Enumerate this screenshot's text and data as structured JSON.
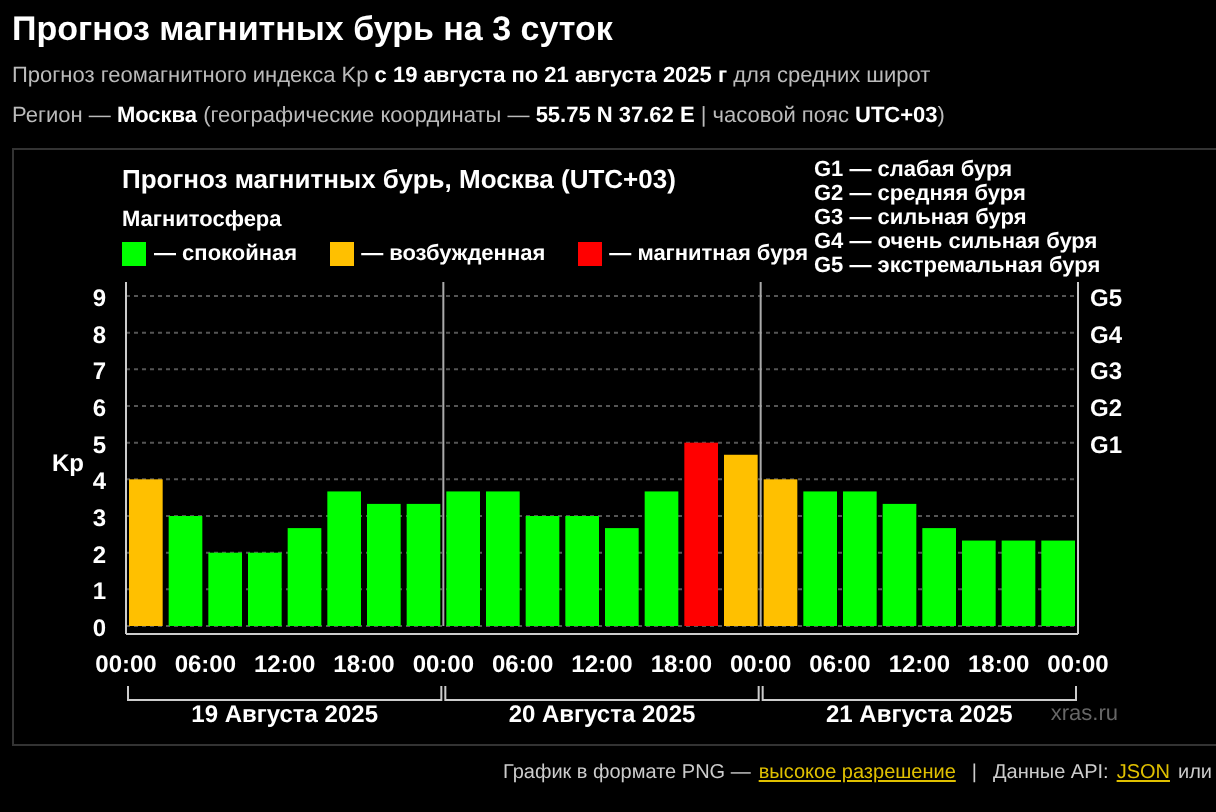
{
  "title": "Прогноз магнитных бурь на 3 суток",
  "subtitle": "Прогноз геомагнитного индекса Kp **с 19 августа по 21 августа 2025 г** для средних широт",
  "region_line": "Регион — **Москва** (географические координаты — **55.75 N 37.62 E** | часовой пояс **UTC+03**)",
  "chart": {
    "legend_title": "Магнитосфера",
    "g_scale": [
      "G1 — слабая буря",
      "G2 — средняя буря",
      "G3 — сильная буря",
      "G4 — очень сильная буря",
      "G5 — экстремальная буря"
    ],
    "g_ticks": [
      "G5",
      "G4",
      "G3",
      "G2",
      "G1"
    ],
    "x_labels": [
      "00:00",
      "06:00",
      "12:00",
      "18:00",
      "00:00",
      "06:00",
      "12:00",
      "18:00",
      "00:00",
      "06:00",
      "12:00",
      "18:00",
      "00:00"
    ],
    "days": [
      "19 Августа 2025",
      "20 Августа 2025",
      "21 Августа 2025"
    ],
    "source": "xras.ru",
    "chart_data": {
      "type": "bar",
      "title": "Прогноз магнитных бурь, Москва (UTC+03)",
      "ylabel": "Kp",
      "stacked": true,
      "grid": true,
      "ylim": [
        0,
        9
      ],
      "yticks": [
        0,
        1,
        2,
        3,
        4,
        5,
        6,
        7,
        8,
        9
      ],
      "series": [
        {
          "name": "— спокойная",
          "color": "#00ff00",
          "values": [
            null,
            3,
            2,
            2,
            2.67,
            3.67,
            3.33,
            3.33,
            3.67,
            3.67,
            3,
            3,
            2.67,
            3.67,
            null,
            null,
            null,
            3.67,
            3.67,
            3.33,
            2.67,
            2.33,
            2.33,
            2.33
          ]
        },
        {
          "name": "— возбужденная",
          "color": "#ffc000",
          "values": [
            4,
            null,
            null,
            null,
            null,
            null,
            null,
            null,
            null,
            null,
            null,
            null,
            null,
            null,
            null,
            4.67,
            4,
            null,
            null,
            null,
            null,
            null,
            null,
            null
          ]
        },
        {
          "name": "— магнитная буря",
          "color": "#ff0000",
          "values": [
            null,
            null,
            null,
            null,
            null,
            null,
            null,
            null,
            null,
            null,
            null,
            null,
            null,
            null,
            5,
            null,
            null,
            null,
            null,
            null,
            null,
            null,
            null,
            null
          ]
        }
      ]
    }
  },
  "footer": {
    "text": "График в формате PNG —",
    "link": "высокое разрешение",
    "separator": "|",
    "api_text": "Данные API:",
    "api_link": "JSON",
    "tail": "или"
  }
}
